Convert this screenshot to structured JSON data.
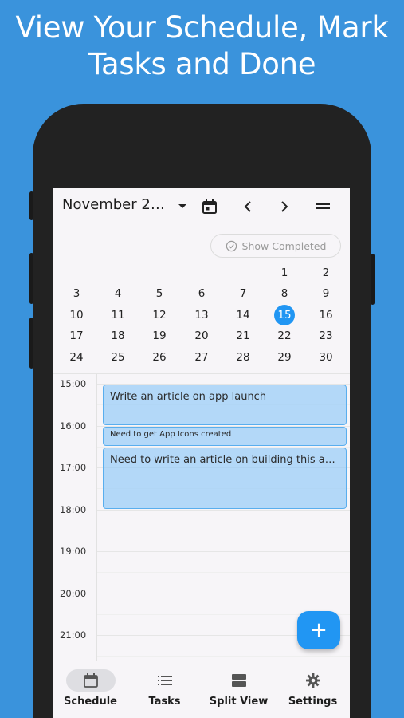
{
  "headline": {
    "line1": "View Your Schedule, Mark",
    "line2": "Tasks and Done"
  },
  "toolbar": {
    "month_title": "November 2…",
    "icons": [
      "dropdown-arrow-icon",
      "calendar-icon",
      "chevron-left-icon",
      "chevron-right-icon",
      "menu-icon"
    ]
  },
  "show_completed": {
    "label": "Show Completed",
    "icon": "check-circle-icon"
  },
  "calendar": {
    "selected_day": "15",
    "rows": [
      [
        "",
        "",
        "",
        "",
        "",
        "1",
        "2"
      ],
      [
        "3",
        "4",
        "5",
        "6",
        "7",
        "8",
        "9"
      ],
      [
        "10",
        "11",
        "12",
        "13",
        "14",
        "15",
        "16"
      ],
      [
        "17",
        "18",
        "19",
        "20",
        "21",
        "22",
        "23"
      ],
      [
        "24",
        "25",
        "26",
        "27",
        "28",
        "29",
        "30"
      ]
    ]
  },
  "timeline": {
    "hours": [
      "15:00",
      "16:00",
      "17:00",
      "18:00",
      "19:00",
      "20:00",
      "21:00"
    ],
    "events": [
      {
        "title": "Write an article on app launch",
        "start": "15:00",
        "end": "16:00"
      },
      {
        "title": "Need to get App Icons created",
        "start": "16:00",
        "end": "16:30"
      },
      {
        "title": "Need to write an article on building this a…",
        "start": "16:30",
        "end": "18:00"
      }
    ]
  },
  "fab": {
    "label": "+"
  },
  "bottom_nav": {
    "active": "Schedule",
    "items": [
      {
        "label": "Schedule",
        "icon": "calendar-icon"
      },
      {
        "label": "Tasks",
        "icon": "list-icon"
      },
      {
        "label": "Split View",
        "icon": "split-view-icon"
      },
      {
        "label": "Settings",
        "icon": "gear-icon"
      }
    ]
  },
  "colors": {
    "background": "#3a93dc",
    "accent": "#2196f3",
    "event_fill": "#b7dbf8",
    "phone": "#222222"
  }
}
